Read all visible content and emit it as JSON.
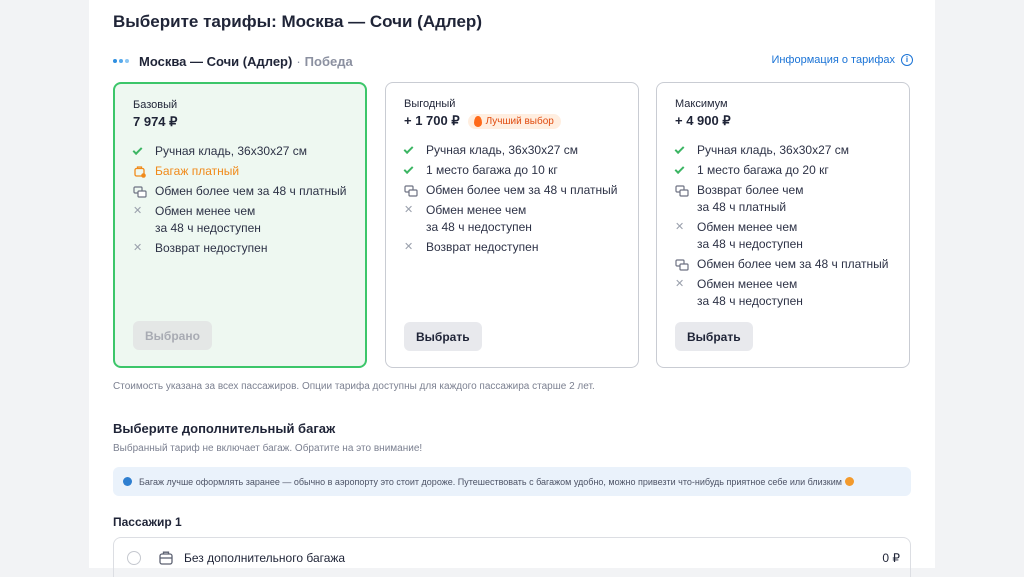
{
  "page": {
    "title": "Выберите тарифы: Москва — Сочи (Адлер)"
  },
  "route": {
    "name": "Москва — Сочи (Адлер)",
    "separator": "·",
    "carrier": "Победа",
    "fare_info_link": "Информация о тарифах",
    "info_icon": "i"
  },
  "tariffs": [
    {
      "name": "Базовый",
      "price": "7 974 ₽",
      "selected": true,
      "button": "Выбрано",
      "features": [
        {
          "icon": "check-icon",
          "text": "Ручная кладь, 36x30x27 см"
        },
        {
          "icon": "paid-bag-icon",
          "text": "Багаж платный"
        },
        {
          "icon": "exchange-icon",
          "text": "Обмен более чем за 48 ч платный"
        },
        {
          "icon": "cross-icon",
          "text": "Обмен менее чем",
          "text2": "за 48 ч недоступен"
        },
        {
          "icon": "cross-icon",
          "text": "Возврат недоступен"
        }
      ]
    },
    {
      "name": "Выгодный",
      "price": "+ 1 700 ₽",
      "badge": "Лучший выбор",
      "button": "Выбрать",
      "features": [
        {
          "icon": "check-icon",
          "text": "Ручная кладь, 36x30x27 см"
        },
        {
          "icon": "check-icon",
          "text": "1 место багажа до 10 кг"
        },
        {
          "icon": "exchange-icon",
          "text": "Обмен более чем за 48 ч платный"
        },
        {
          "icon": "cross-icon",
          "text": "Обмен менее чем",
          "text2": "за 48 ч недоступен"
        },
        {
          "icon": "cross-icon",
          "text": "Возврат недоступен"
        }
      ]
    },
    {
      "name": "Максимум",
      "price": "+ 4 900 ₽",
      "button": "Выбрать",
      "features": [
        {
          "icon": "check-icon",
          "text": "Ручная кладь, 36x30x27 см"
        },
        {
          "icon": "check-icon",
          "text": "1 место багажа до 20 кг"
        },
        {
          "icon": "exchange-icon",
          "text": "Возврат более чем",
          "text2": "за 48 ч платный"
        },
        {
          "icon": "cross-icon",
          "text": "Обмен менее чем",
          "text2": "за 48 ч недоступен"
        },
        {
          "icon": "exchange-icon",
          "text": "Обмен более чем за 48 ч платный"
        },
        {
          "icon": "cross-icon",
          "text": "Обмен менее чем",
          "text2": "за 48 ч недоступен"
        }
      ]
    }
  ],
  "note": "Стоимость указана за всех пассажиров. Опции тарифа доступны для каждого пассажира старше 2 лет.",
  "baggage": {
    "title": "Выберите дополнительный багаж",
    "subtitle": "Выбранный тариф не включает багаж. Обратите на это внимание!",
    "tip": "Багаж лучше оформлять заранее — обычно в аэропорту это стоит дороже. Путешествовать с багажом удобно, можно привезти что-нибудь приятное себе или близким",
    "passenger_title": "Пассажир 1",
    "option_label": "Без дополнительного багажа",
    "option_price": "0 ₽"
  },
  "colors": {
    "accent_green": "#3cc66a",
    "link_blue": "#1a73d6",
    "warn_orange": "#f08a1a",
    "badge_bg": "#ffeee0"
  }
}
